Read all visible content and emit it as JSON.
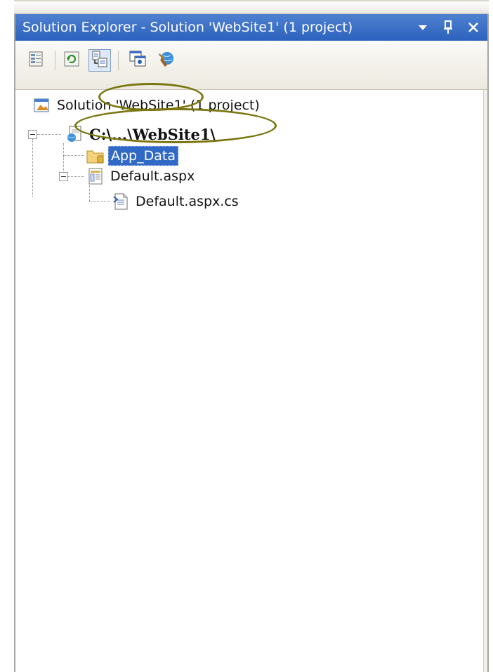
{
  "window": {
    "title": "Solution Explorer - Solution 'WebSite1' (1 project)",
    "buttons": [
      {
        "name": "dropdown",
        "icon": "dropdown-arrow-icon"
      },
      {
        "name": "pin",
        "icon": "pin-icon"
      },
      {
        "name": "close",
        "icon": "close-icon"
      }
    ]
  },
  "toolbar": {
    "items": [
      {
        "name": "properties",
        "icon": "properties-icon"
      },
      {
        "name": "refresh",
        "icon": "refresh-icon"
      },
      {
        "name": "nest-related-files",
        "icon": "nest-files-icon"
      },
      {
        "name": "view-designer",
        "icon": "view-designer-icon"
      },
      {
        "name": "asp-net-configuration",
        "icon": "web-configuration-icon"
      }
    ]
  },
  "tree": {
    "solution_label": "Solution 'WebSite1' (1 project)",
    "project_label": "C:\\...\\WebSite1\\",
    "app_data_label": "App_Data",
    "default_aspx_label": "Default.aspx",
    "default_cs_label": "Default.aspx.cs",
    "selected": "App_Data"
  },
  "colors": {
    "titlebar": "#2c62be",
    "selection": "#3169c6",
    "annotation": "#7a7610"
  }
}
